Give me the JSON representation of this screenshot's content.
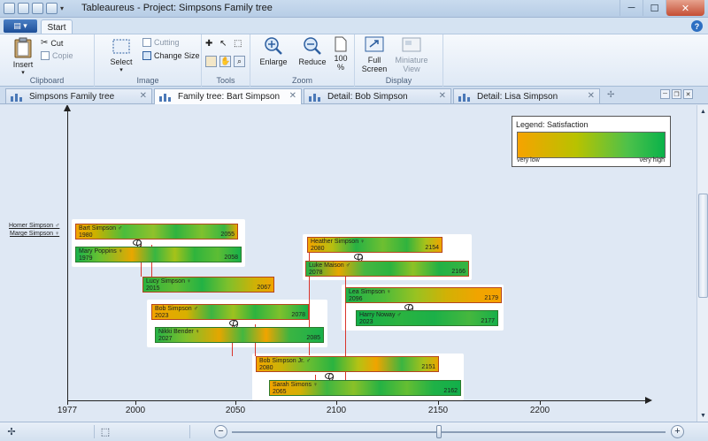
{
  "window": {
    "title": "Tableaureus - Project: Simpsons Family tree"
  },
  "ribbon_tabs": {
    "start": "Start"
  },
  "ribbon": {
    "clipboard": {
      "label": "Clipboard",
      "insert": "Insert",
      "cut": "Cut",
      "copy": "Copie"
    },
    "image": {
      "label": "Image",
      "select": "Select",
      "cutting": "Cutting",
      "change_size": "Change Size"
    },
    "tools": {
      "label": "Tools"
    },
    "zoom": {
      "label": "Zoom",
      "enlarge": "Enlarge",
      "reduce": "Reduce",
      "percent_top": "100",
      "percent_bottom": "%"
    },
    "display": {
      "label": "Display",
      "full_screen_1": "Full",
      "full_screen_2": "Screen",
      "miniature_1": "Miniature",
      "miniature_2": "View"
    }
  },
  "doc_tabs": [
    {
      "label": "Simpsons Family tree"
    },
    {
      "label": "Family tree: Bart Simpson"
    },
    {
      "label": "Detail: Bob Simpson"
    },
    {
      "label": "Detail: Lisa Simpson"
    }
  ],
  "legend": {
    "title": "Legend: Satisfaction",
    "low": "very low",
    "high": "very high"
  },
  "parents": [
    {
      "label": "Homer Simpson ♂"
    },
    {
      "label": "Marge Simpson ♀"
    }
  ],
  "people": [
    {
      "name": "Bart Simpson ♂",
      "born": "1980",
      "died": "2055"
    },
    {
      "name": "Mary Poppins ♀",
      "born": "1979",
      "died": "2058"
    },
    {
      "name": "Lucy Simpson ♀",
      "born": "2015",
      "died": "2067"
    },
    {
      "name": "Bob Simpson ♂",
      "born": "2023",
      "died": "2078"
    },
    {
      "name": "Nikki Bender ♀",
      "born": "2027",
      "died": "2085"
    },
    {
      "name": "Heather Simpson ♀",
      "born": "2080",
      "died": "2154"
    },
    {
      "name": "Luke Maison ♂",
      "born": "2078",
      "died": "2166"
    },
    {
      "name": "Lea Simpson ♀",
      "born": "2096",
      "died": "2179"
    },
    {
      "name": "Harry Noway ♂",
      "born": "2023",
      "died": "2177"
    },
    {
      "name": "Bob Simpson Jr. ♂",
      "born": "2080",
      "died": "2151"
    },
    {
      "name": "Sarah Simons ♀",
      "born": "2065",
      "died": "2162"
    }
  ],
  "axis": {
    "ticks": [
      "1977",
      "2000",
      "2050",
      "2100",
      "2150",
      "2200"
    ]
  },
  "colors": {
    "satisfaction_low": "#f6a300",
    "satisfaction_high": "#0ab24a",
    "link_line": "#d9342b"
  }
}
